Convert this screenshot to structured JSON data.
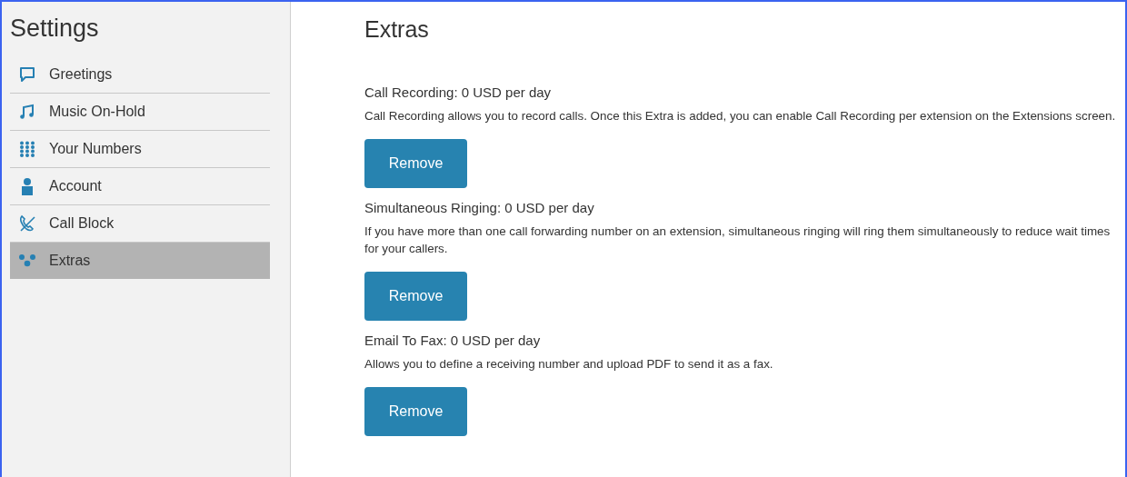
{
  "sidebar": {
    "title": "Settings",
    "items": [
      {
        "label": "Greetings",
        "selected": false
      },
      {
        "label": "Music On-Hold",
        "selected": false
      },
      {
        "label": "Your Numbers",
        "selected": false
      },
      {
        "label": "Account",
        "selected": false
      },
      {
        "label": "Call Block",
        "selected": false
      },
      {
        "label": "Extras",
        "selected": true
      }
    ]
  },
  "main": {
    "title": "Extras",
    "extras": [
      {
        "name": "Call Recording: 0 USD per day",
        "description": "Call Recording allows you to record calls. Once this Extra is added, you can enable Call Recording per extension on the Extensions screen.",
        "button": "Remove"
      },
      {
        "name": "Simultaneous Ringing: 0 USD per day",
        "description": "If you have more than one call forwarding number on an extension, simultaneous ringing will ring them simultaneously to reduce wait times for your callers.",
        "button": "Remove"
      },
      {
        "name": "Email To Fax: 0 USD per day",
        "description": "Allows you to define a receiving number and upload PDF to send it as a fax.",
        "button": "Remove"
      }
    ]
  }
}
